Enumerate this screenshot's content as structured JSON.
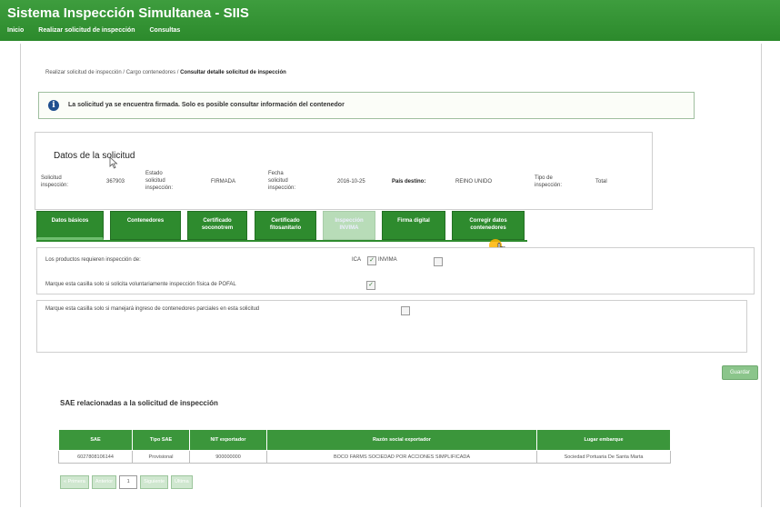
{
  "app": {
    "title": "Sistema Inspección Simultanea - SIIS",
    "menu": [
      "Inicio",
      "Realizar solicitud de inspección",
      "Consultas"
    ]
  },
  "breadcrumb": {
    "path": "Realizar solicitud de inspección / Cargo contenedores / ",
    "current": "Consultar detalle solicitud de inspección"
  },
  "alert": {
    "icon": "info-icon",
    "text": "La solicitud ya se encuentra firmada. Solo es posible consultar información del contenedor"
  },
  "solicitud": {
    "title": "Datos de la solicitud",
    "solicitud_label": "Solicitud\ninspección:",
    "solicitud_value": "367903",
    "estado_label": "Estado\nsolicitud\ninspección:",
    "estado_value": "FIRMADA",
    "fecha_label": "Fecha\nsolicitud\ninspección:",
    "fecha_value": "2016-10-25",
    "pais_label": "País destino:",
    "pais_value": "REINO UNIDO",
    "tipo_label": "Tipo de\ninspección:",
    "tipo_value": "Total"
  },
  "tabs": [
    {
      "label": "Datos básicos",
      "state": "active"
    },
    {
      "label": "Contenedores",
      "state": "normal"
    },
    {
      "label": "Certificado\nsoconotrem",
      "state": "normal"
    },
    {
      "label": "Certificado\nfitosanitario",
      "state": "normal"
    },
    {
      "label": "Inspección\nINVIMA",
      "state": "disabled"
    },
    {
      "label": "Firma digital",
      "state": "normal"
    },
    {
      "label": "Corregir datos\ncontenedores",
      "state": "normal"
    }
  ],
  "basic": {
    "productos_label": "Los productos requieren inspección de:",
    "ica_label": "ICA",
    "ica_checked": true,
    "invima_label": "INVIMA",
    "invima_checked": false,
    "polfa_label": "Marque esta casilla solo si solicita voluntariamente inspección física de  POFAL",
    "polfa_checked": true,
    "parciales_label": "Marque esta casilla solo si manejará ingreso de contenedores parciales en esta solicitud",
    "parciales_checked": false
  },
  "mini_button": "Guardar",
  "sae": {
    "title": "SAE relacionadas a la solicitud de inspección",
    "columns": [
      "SAE",
      "Tipo SAE",
      "NIT exportador",
      "Razón social exportador",
      "Lugar embarque"
    ],
    "rows": [
      [
        "6027808106144",
        "Provisional",
        "900000000",
        "BOCO FARMS SOCIEDAD POR ACCIONES SIMPLIFICADA",
        "Sociedad Portuaria De Santa Marta"
      ]
    ]
  },
  "pager": {
    "first": "« Primera",
    "prev": "Anterior",
    "page": "1",
    "next": "Siguiente",
    "last": "Última"
  }
}
